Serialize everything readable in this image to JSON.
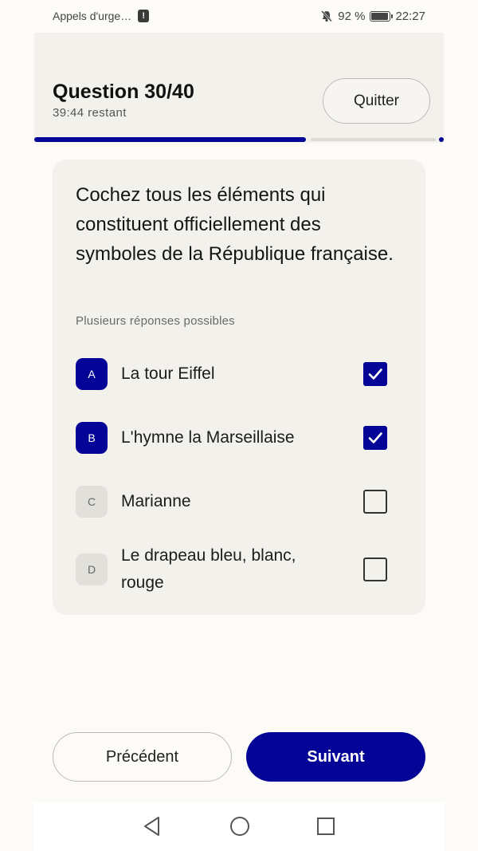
{
  "status_bar": {
    "left_text": "Appels d'urge…",
    "alert_glyph": "!",
    "battery_text": "92 %",
    "battery_level": 0.92,
    "time": "22:27",
    "icons": [
      "alert-icon",
      "bell-muted-icon",
      "battery-icon"
    ]
  },
  "header": {
    "question_label": "Question 30/40",
    "timer": "39:44 restant",
    "quit_label": "Quitter",
    "progress": 0.75
  },
  "question": {
    "text": "Cochez tous les éléments qui constituent officiellement des symboles de la République française.",
    "hint": "Plusieurs réponses possibles",
    "options": [
      {
        "letter": "A",
        "label": "La tour Eiffel",
        "checked": true
      },
      {
        "letter": "B",
        "label": "L'hymne la Marseillaise",
        "checked": true
      },
      {
        "letter": "C",
        "label": "Marianne",
        "checked": false
      },
      {
        "letter": "D",
        "label": "Le drapeau bleu, blanc, rouge",
        "checked": false
      }
    ]
  },
  "footer": {
    "prev_label": "Précédent",
    "next_label": "Suivant"
  },
  "colors": {
    "accent": "#040496",
    "card": "#f3f1ec",
    "background": "#fcfbf8"
  },
  "system_nav": {
    "icons": [
      "back-triangle-icon",
      "home-circle-icon",
      "recents-square-icon"
    ]
  }
}
